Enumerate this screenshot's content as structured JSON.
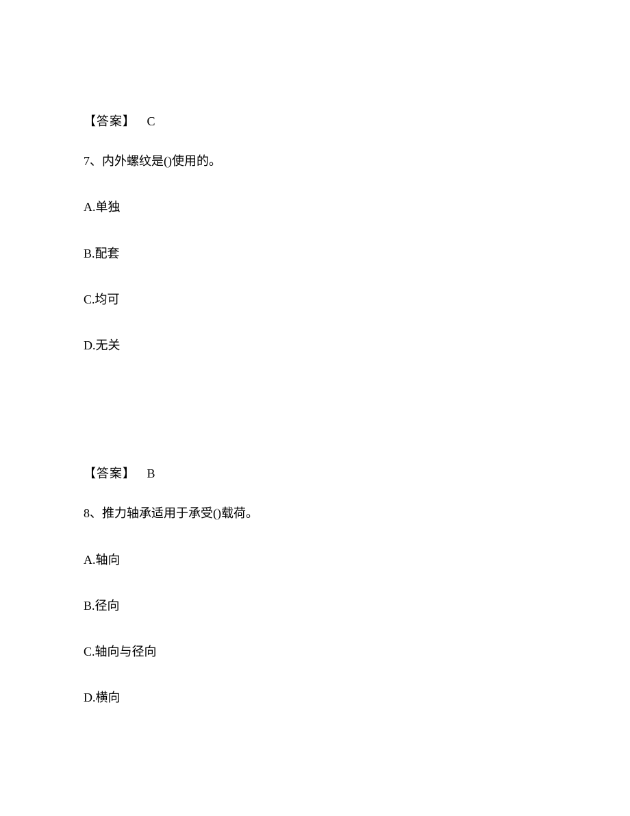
{
  "prev_answer": {
    "label": "【答案】",
    "value": "C"
  },
  "q7": {
    "number": "7、",
    "text": "内外螺纹是()使用的。",
    "options": {
      "a": "A.单独",
      "b": "B.配套",
      "c": "C.均可",
      "d": "D.无关"
    },
    "answer_label": "【答案】",
    "answer_value": "B"
  },
  "q8": {
    "number": "8、",
    "text": "推力轴承适用于承受()载荷。",
    "options": {
      "a": "A.轴向",
      "b": "B.径向",
      "c": "C.轴向与径向",
      "d": "D.横向"
    }
  }
}
